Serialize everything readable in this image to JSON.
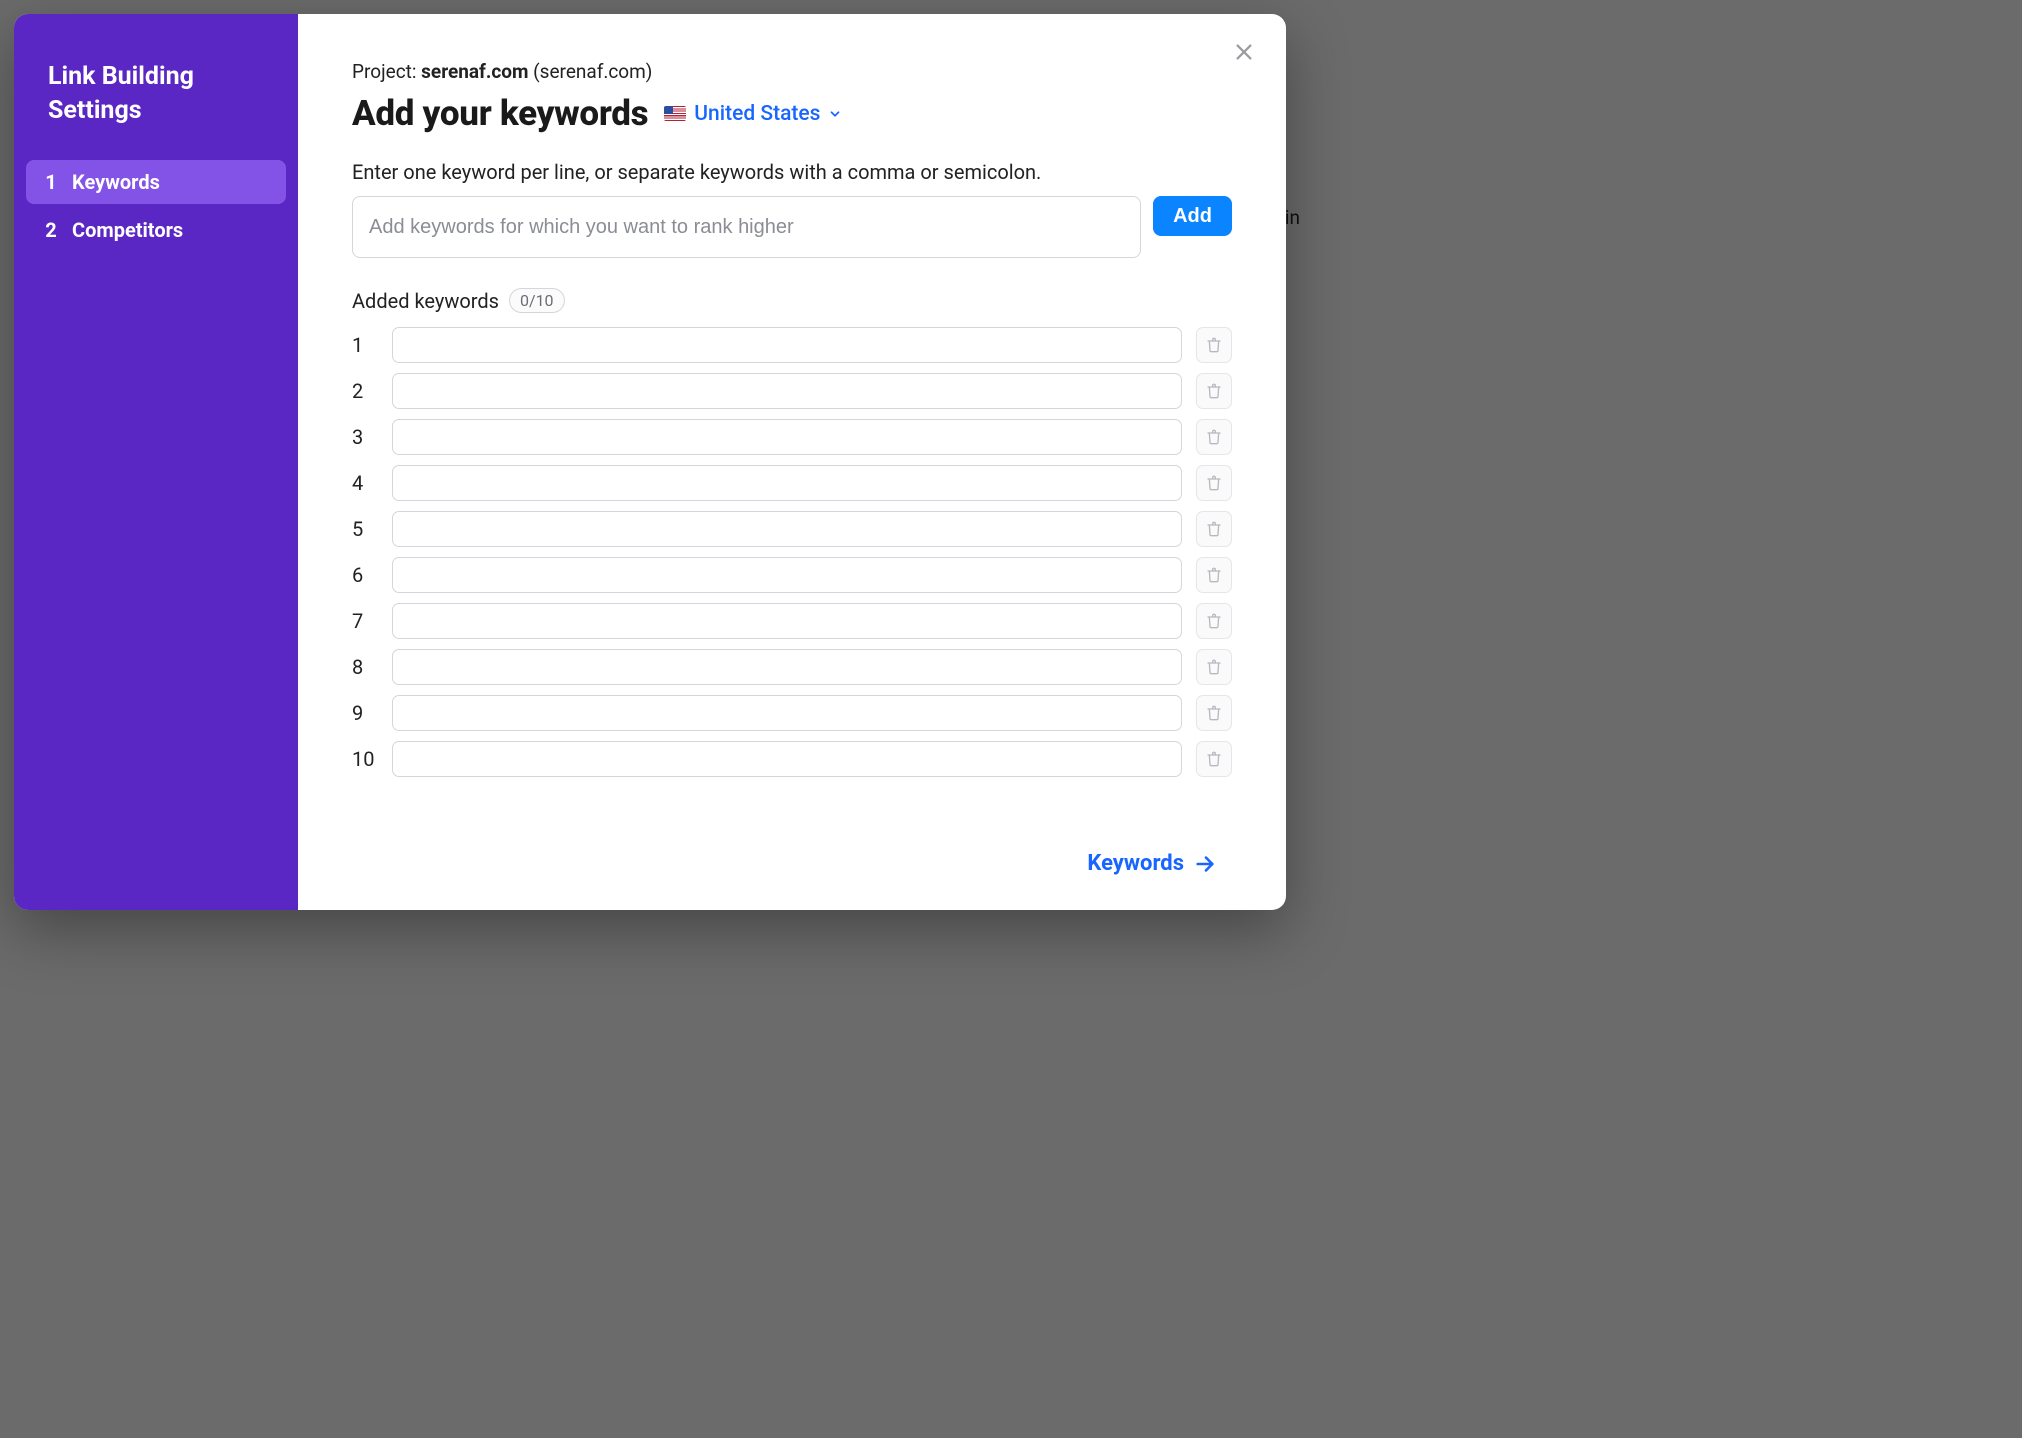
{
  "backdrop": {
    "rightText": "Lin"
  },
  "sidebar": {
    "title": "Link Building Settings",
    "items": [
      {
        "num": "1",
        "label": "Keywords",
        "active": true
      },
      {
        "num": "2",
        "label": "Competitors",
        "active": false
      }
    ]
  },
  "header": {
    "projectPrefix": "Project: ",
    "projectName": "serenaf.com",
    "projectSuffix": " (serenaf.com)",
    "title": "Add your keywords",
    "country": "United States"
  },
  "form": {
    "instructions": "Enter one keyword per line, or separate keywords with a comma or semicolon.",
    "placeholder": "Add keywords for which you want to rank higher",
    "addLabel": "Add",
    "addedLabel": "Added keywords",
    "countBadge": "0/10",
    "rows": [
      "1",
      "2",
      "3",
      "4",
      "5",
      "6",
      "7",
      "8",
      "9",
      "10"
    ]
  },
  "footer": {
    "nextLabel": "Keywords"
  }
}
